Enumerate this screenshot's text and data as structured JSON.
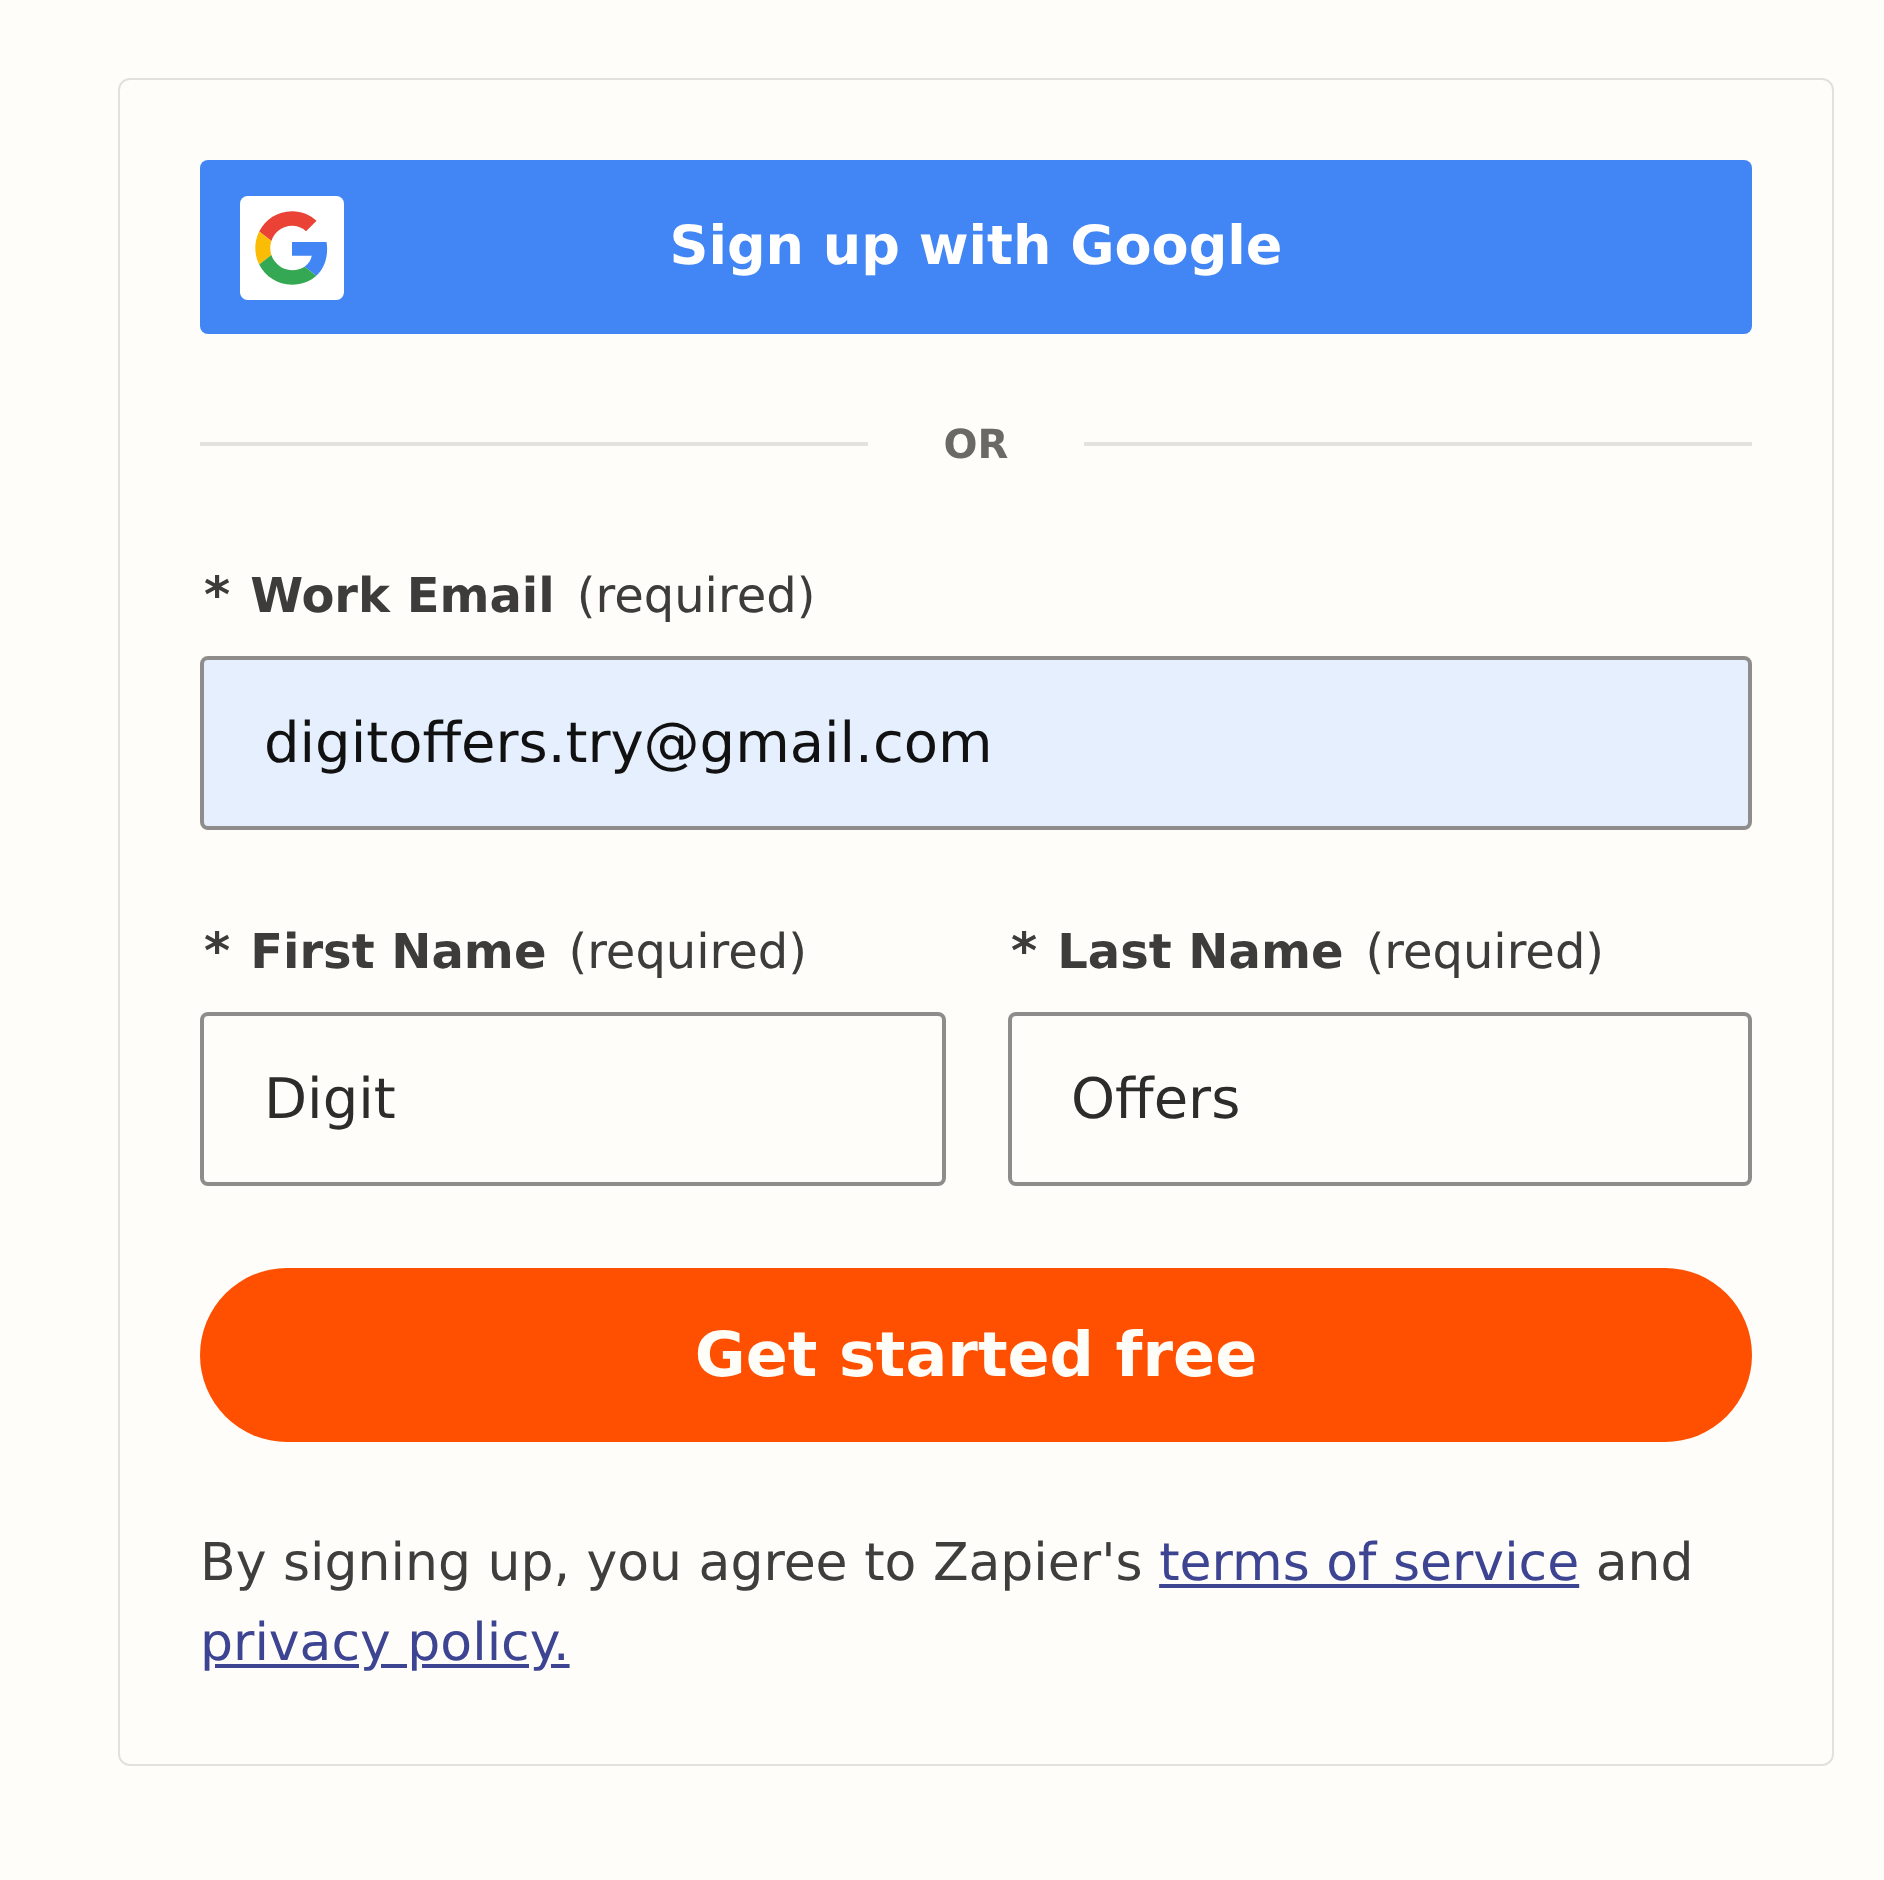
{
  "google_button": {
    "label": "Sign up with Google"
  },
  "divider": {
    "label": "OR"
  },
  "email_field": {
    "required_mark": "*",
    "label": "Work Email",
    "note": "(required)",
    "value": "digitoffers.try@gmail.com",
    "autofilled": true
  },
  "name_fields": [
    {
      "required_mark": "*",
      "label": "First Name",
      "note": "(required)",
      "value": "Digit",
      "autofilled": false
    },
    {
      "required_mark": "*",
      "label": "Last Name",
      "note": "(required)",
      "value": "Offers",
      "autofilled": false
    }
  ],
  "submit_button": {
    "label": "Get started free"
  },
  "legal": {
    "parts": [
      {
        "kind": "text",
        "text": "By signing up, you agree to Zapier's"
      },
      {
        "kind": "link",
        "text": "terms of service"
      },
      {
        "kind": "text",
        "text": "and"
      },
      {
        "kind": "link",
        "text": "privacy policy."
      }
    ]
  }
}
